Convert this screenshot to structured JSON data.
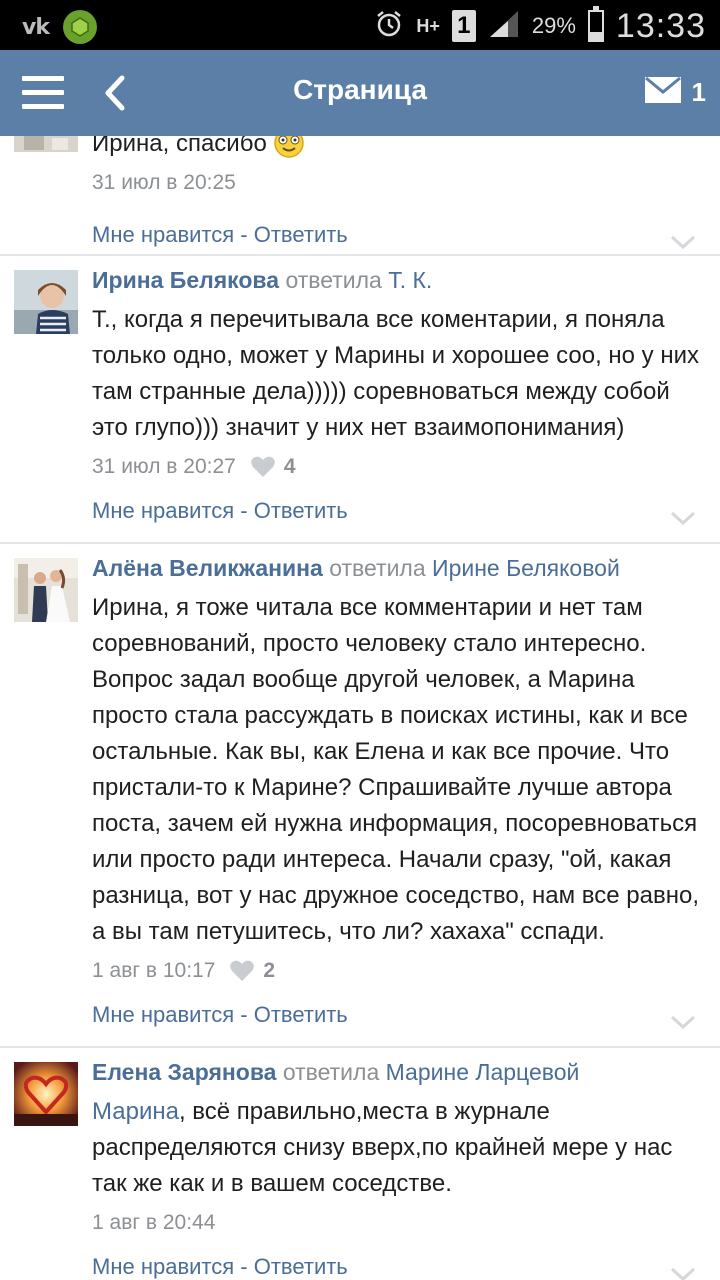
{
  "status_bar": {
    "vk_logo": "vk",
    "network": "H+",
    "sim": "1",
    "battery_percent": "29%",
    "battery_level": 0.29,
    "time": "13:33"
  },
  "header": {
    "title": "Страница",
    "mail_count": "1"
  },
  "comments": [
    {
      "text": "Ирина, спасибо",
      "date": "31 июл в 20:25",
      "like_label": "Мне нравится",
      "separator": " - ",
      "reply_label": "Ответить"
    },
    {
      "author": "Ирина Белякова",
      "replied": "ответила",
      "reply_to": "Т. К.",
      "text": "Т., когда я перечитывала все коментарии, я поняла только одно, может у Марины и хорошее соо, но у них там странные дела))))) соревноваться между собой это глупо))) значит у них нет взаимопонимания)",
      "date": "31 июл в 20:27",
      "likes": "4",
      "like_label": "Мне нравится",
      "separator": " - ",
      "reply_label": "Ответить"
    },
    {
      "author": "Алёна Великжанина",
      "replied": "ответила",
      "reply_to": "Ирине Беляковой",
      "text": "Ирина, я тоже читала все комментарии и нет там соревнований, просто человеку стало интересно. Вопрос задал вообще другой человек, а Марина просто стала рассуждать в поисках истины, как и все остальные. Как вы, как Елена и как все прочие. Что пристали-то к Марине? Спрашивайте лучше автора поста, зачем ей нужна информация, посоревноваться или просто ради интереса. Начали сразу, \"ой, какая разница, вот у нас дружное соседство, нам все равно, а вы там петушитесь, что ли? хахаха\" сспади.",
      "date": "1 авг в 10:17",
      "likes": "2",
      "like_label": "Мне нравится",
      "separator": " - ",
      "reply_label": "Ответить"
    },
    {
      "author": "Елена Зарянова",
      "replied": "ответила",
      "reply_to": "Марине Ларцевой",
      "mention": "Марина",
      "text": ", всё правильно,места в журнале распределяются снизу вверх,по крайней мере у нас так же как и в вашем соседстве.",
      "date": "1 авг в 20:44",
      "like_label": "Мне нравится",
      "separator": " - ",
      "reply_label": "Ответить"
    }
  ],
  "colors": {
    "header_bg": "#5b7fa6",
    "link": "#4a6e98",
    "meta": "#8c8f93"
  }
}
